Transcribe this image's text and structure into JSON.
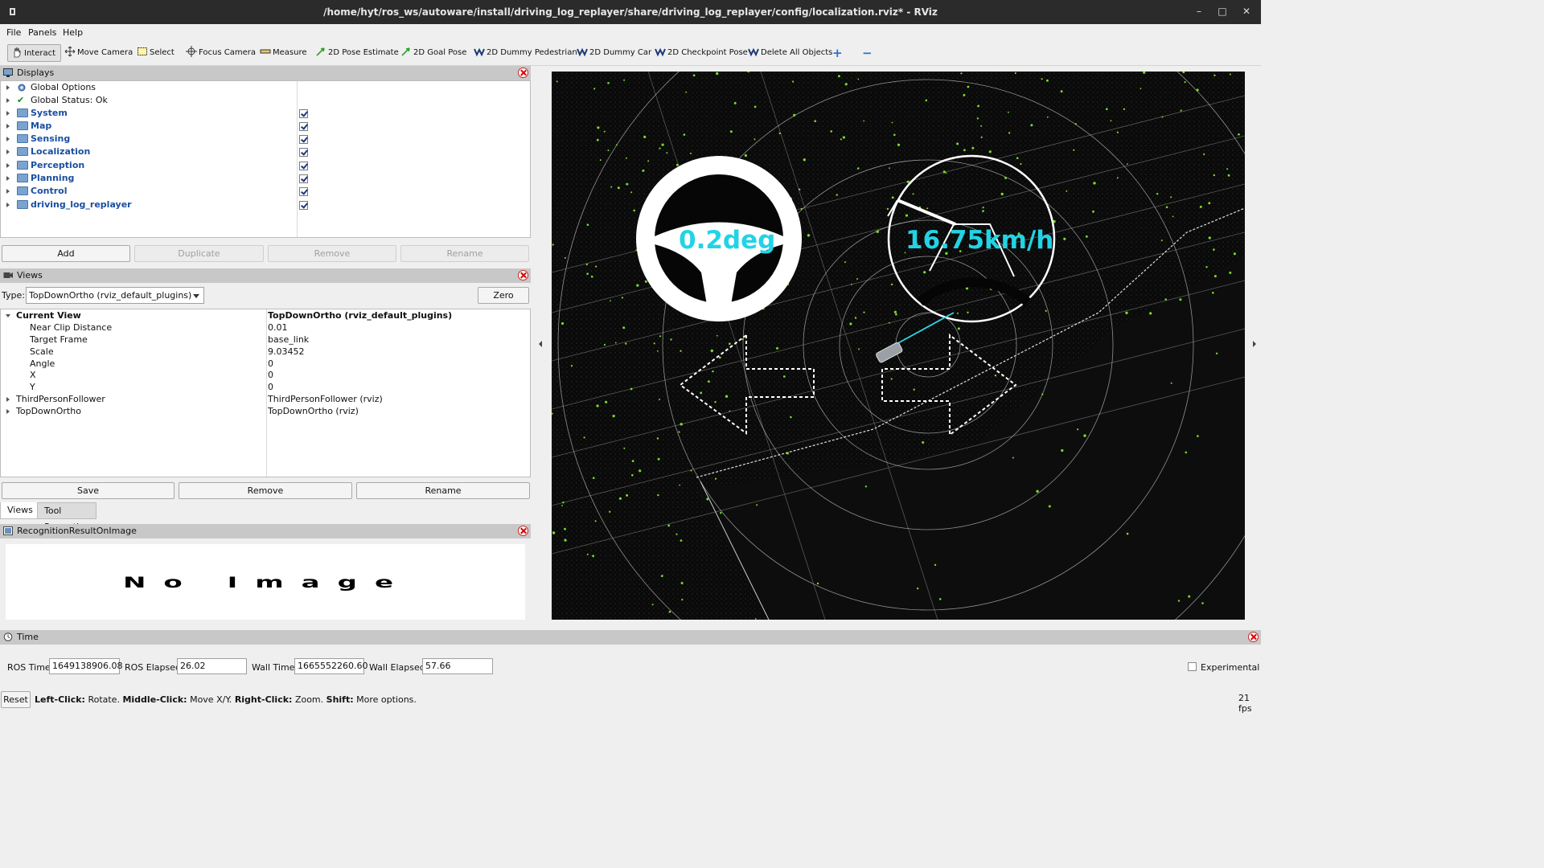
{
  "window": {
    "title": "/home/hyt/ros_ws/autoware/install/driving_log_replayer/share/driving_log_replayer/config/localization.rviz* - RViz",
    "minimize": "–",
    "maximize": "□",
    "close": "✕"
  },
  "menu": [
    "File",
    "Panels",
    "Help"
  ],
  "toolbar": {
    "interact": "Interact",
    "move_camera": "Move Camera",
    "select": "Select",
    "focus_camera": "Focus Camera",
    "measure": "Measure",
    "pose_estimate": "2D Pose Estimate",
    "goal_pose": "2D Goal Pose",
    "dummy_pedestrian": "2D Dummy Pedestrian",
    "dummy_car": "2D Dummy Car",
    "checkpoint_pose": "2D Checkpoint Pose",
    "delete_all": "Delete All Objects",
    "add_tool": "+",
    "remove_tool": "−"
  },
  "displays": {
    "title": "Displays",
    "items": [
      {
        "label": "Global Options"
      },
      {
        "label": "Global Status: Ok"
      },
      {
        "label": "System",
        "checked": true
      },
      {
        "label": "Map",
        "checked": true
      },
      {
        "label": "Sensing",
        "checked": true
      },
      {
        "label": "Localization",
        "checked": true
      },
      {
        "label": "Perception",
        "checked": true
      },
      {
        "label": "Planning",
        "checked": true
      },
      {
        "label": "Control",
        "checked": true
      },
      {
        "label": "driving_log_replayer",
        "checked": true
      }
    ],
    "buttons": {
      "add": "Add",
      "duplicate": "Duplicate",
      "remove": "Remove",
      "rename": "Rename"
    }
  },
  "views": {
    "title": "Views",
    "type_label": "Type:",
    "type_value": "TopDownOrtho (rviz_default_plugins)",
    "zero": "Zero",
    "current_view": {
      "label": "Current View",
      "value": "TopDownOrtho (rviz_default_plugins)"
    },
    "props": [
      {
        "key": "Near Clip Distance",
        "value": "0.01"
      },
      {
        "key": "Target Frame",
        "value": "base_link"
      },
      {
        "key": "Scale",
        "value": "9.03452"
      },
      {
        "key": "Angle",
        "value": "0"
      },
      {
        "key": "X",
        "value": "0"
      },
      {
        "key": "Y",
        "value": "0"
      }
    ],
    "others": [
      {
        "key": "ThirdPersonFollower",
        "value": "ThirdPersonFollower (rviz)"
      },
      {
        "key": "TopDownOrtho",
        "value": "TopDownOrtho (rviz)"
      }
    ],
    "buttons": {
      "save": "Save",
      "remove": "Remove",
      "rename": "Rename"
    },
    "tabs": [
      "Views",
      "Tool Properties"
    ]
  },
  "recognition": {
    "title": "RecognitionResultOnImage",
    "no_image": "No Image"
  },
  "viewport": {
    "steering": "0.2deg",
    "speed": "16.75km/h",
    "overlay_color": "#22d3e6"
  },
  "time": {
    "title": "Time",
    "ros_time_label": "ROS Time:",
    "ros_time": "1649138906.08",
    "ros_elapsed_label": "ROS Elapsed:",
    "ros_elapsed": "26.02",
    "wall_time_label": "Wall Time:",
    "wall_time": "1665552260.60",
    "wall_elapsed_label": "Wall Elapsed:",
    "wall_elapsed": "57.66",
    "experimental": "Experimental"
  },
  "status": {
    "reset": "Reset",
    "left_click": "Left-Click:",
    "left_click_desc": "Rotate.",
    "middle_click": "Middle-Click:",
    "middle_click_desc": "Move X/Y.",
    "right_click": "Right-Click:",
    "right_click_desc": "Zoom.",
    "shift": "Shift:",
    "shift_desc": "More options.",
    "fps": "21 fps"
  }
}
